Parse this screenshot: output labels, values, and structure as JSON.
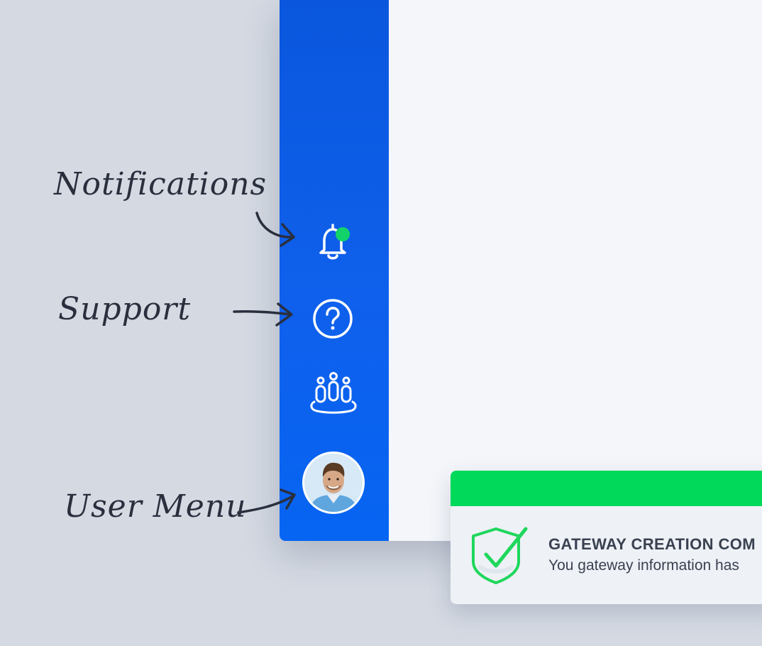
{
  "annotations": {
    "notifications": "Notifications",
    "support": "Support",
    "user_menu": "User Menu"
  },
  "sidebar": {
    "icons": [
      "bell-icon",
      "help-circle-icon",
      "team-icon",
      "user-avatar"
    ],
    "notification_dot_color": "#12d36a",
    "background_color": "#0a5ce6"
  },
  "toast": {
    "title": "GATEWAY CREATION COM",
    "message": "You gateway information has",
    "accent_color": "#00d95a",
    "icon": "shield-check-icon"
  }
}
